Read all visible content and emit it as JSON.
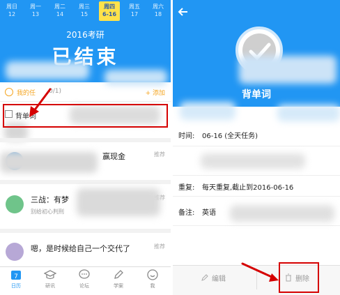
{
  "week": {
    "days": [
      {
        "name": "周日",
        "date": "12"
      },
      {
        "name": "周一",
        "date": "13"
      },
      {
        "name": "周二",
        "date": "14"
      },
      {
        "name": "周三",
        "date": "15"
      },
      {
        "name": "周四",
        "date": "6-16"
      },
      {
        "name": "周五",
        "date": "17"
      },
      {
        "name": "周六",
        "date": "18"
      }
    ]
  },
  "left": {
    "exam_title": "2016考研",
    "exam_status": "已结束",
    "task_title": "我的任",
    "task_count": "0/1)",
    "add_label": "+ 添加",
    "task_item": "背单词",
    "feed": [
      {
        "text": "赢现金",
        "tag": "推荐"
      },
      {
        "text": "三战：有梦",
        "sub": "别给初心判刑",
        "tag": "推荐"
      },
      {
        "text": "嗯，是时候给自己一个交代了",
        "tag": "推荐"
      }
    ],
    "tabs": [
      {
        "label": "日历",
        "badge": "7"
      },
      {
        "label": "研讯"
      },
      {
        "label": "论坛"
      },
      {
        "label": "学案"
      },
      {
        "label": "我"
      }
    ]
  },
  "right": {
    "title": "背单词",
    "time_label": "时间:",
    "time_value": "06-16 (全天任务)",
    "repeat_label": "重复:",
    "repeat_value": "每天重复,截止到2016-06-16",
    "note_label": "备注:",
    "note_value": "英语",
    "edit_label": "编辑",
    "delete_label": "删除"
  },
  "colors": {
    "primary": "#2196f3",
    "today_highlight": "#ffe24a",
    "accent": "#f5a623",
    "annotation_red": "#d50000"
  }
}
